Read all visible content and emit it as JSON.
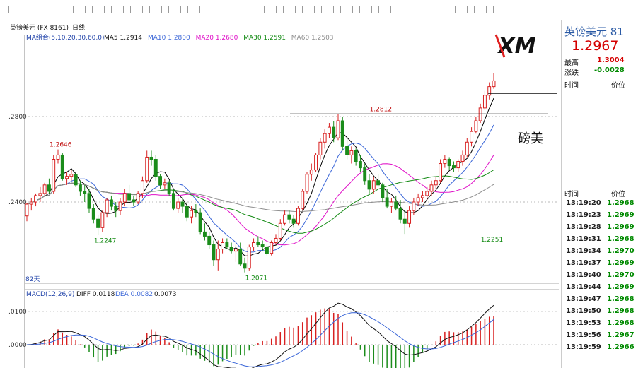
{
  "header": {
    "instrument": "英镑美元 (FX 8161)",
    "period": "日线",
    "ma_label": "MA组合(5,10,20,30,60,0)",
    "ma_values": [
      {
        "name": "MA5",
        "value": "1.2914",
        "color": "#000000"
      },
      {
        "name": "MA10",
        "value": "1.2800",
        "color": "#3a66d8"
      },
      {
        "name": "MA20",
        "value": "1.2680",
        "color": "#e010c8"
      },
      {
        "name": "MA30",
        "value": "1.2591",
        "color": "#138a13"
      },
      {
        "name": "MA60",
        "value": "1.2503",
        "color": "#8e8e8e"
      }
    ]
  },
  "chart_data": [
    {
      "type": "candlestick",
      "ylim": [
        1.202,
        1.318
      ],
      "y_ticks": [
        1.28,
        1.24
      ],
      "y_tick_labels": [
        ".2800",
        ".2400"
      ],
      "annotations": [
        {
          "text": "1.2646",
          "value": 1.2646,
          "index": 7
        },
        {
          "text": "1.2247",
          "value": 1.2247,
          "index": 17
        },
        {
          "text": "1.2812",
          "value": 1.2812,
          "index": 79
        },
        {
          "text": "1.2071",
          "value": 1.2071,
          "index": 51
        },
        {
          "text": "1.2251",
          "value": 1.2251,
          "index": 104
        }
      ],
      "hlines": [
        1.2812,
        1.2908
      ],
      "period_label": "82天",
      "ohlc": [
        [
          1.2335,
          1.2395,
          1.231,
          1.239
        ],
        [
          1.239,
          1.242,
          1.236,
          1.24
        ],
        [
          1.24,
          1.244,
          1.238,
          1.243
        ],
        [
          1.243,
          1.247,
          1.24,
          1.244
        ],
        [
          1.244,
          1.249,
          1.243,
          1.248
        ],
        [
          1.248,
          1.251,
          1.244,
          1.245
        ],
        [
          1.245,
          1.262,
          1.244,
          1.26
        ],
        [
          1.26,
          1.2646,
          1.258,
          1.262
        ],
        [
          1.262,
          1.263,
          1.25,
          1.251
        ],
        [
          1.251,
          1.254,
          1.248,
          1.252
        ],
        [
          1.252,
          1.255,
          1.25,
          1.253
        ],
        [
          1.253,
          1.254,
          1.247,
          1.248
        ],
        [
          1.248,
          1.25,
          1.243,
          1.245
        ],
        [
          1.245,
          1.248,
          1.24,
          1.244
        ],
        [
          1.244,
          1.246,
          1.235,
          1.237
        ],
        [
          1.237,
          1.239,
          1.23,
          1.232
        ],
        [
          1.232,
          1.234,
          1.2247,
          1.228
        ],
        [
          1.228,
          1.236,
          1.226,
          1.235
        ],
        [
          1.235,
          1.242,
          1.233,
          1.241
        ],
        [
          1.241,
          1.243,
          1.236,
          1.238
        ],
        [
          1.238,
          1.24,
          1.233,
          1.236
        ],
        [
          1.236,
          1.242,
          1.234,
          1.24
        ],
        [
          1.24,
          1.246,
          1.238,
          1.244
        ],
        [
          1.244,
          1.248,
          1.24,
          1.241
        ],
        [
          1.241,
          1.243,
          1.238,
          1.24
        ],
        [
          1.24,
          1.245,
          1.239,
          1.244
        ],
        [
          1.244,
          1.252,
          1.242,
          1.25
        ],
        [
          1.25,
          1.264,
          1.249,
          1.261
        ],
        [
          1.261,
          1.264,
          1.257,
          1.26
        ],
        [
          1.26,
          1.262,
          1.25,
          1.252
        ],
        [
          1.252,
          1.253,
          1.246,
          1.248
        ],
        [
          1.248,
          1.251,
          1.246,
          1.249
        ],
        [
          1.249,
          1.25,
          1.243,
          1.244
        ],
        [
          1.244,
          1.246,
          1.236,
          1.237
        ],
        [
          1.237,
          1.242,
          1.235,
          1.24
        ],
        [
          1.24,
          1.242,
          1.235,
          1.238
        ],
        [
          1.238,
          1.24,
          1.231,
          1.233
        ],
        [
          1.233,
          1.238,
          1.23,
          1.236
        ],
        [
          1.236,
          1.239,
          1.233,
          1.235
        ],
        [
          1.235,
          1.237,
          1.225,
          1.226
        ],
        [
          1.226,
          1.23,
          1.222,
          1.224
        ],
        [
          1.224,
          1.226,
          1.218,
          1.22
        ],
        [
          1.22,
          1.222,
          1.21,
          1.213
        ],
        [
          1.213,
          1.222,
          1.208,
          1.218
        ],
        [
          1.218,
          1.223,
          1.216,
          1.221
        ],
        [
          1.221,
          1.223,
          1.218,
          1.219
        ],
        [
          1.219,
          1.221,
          1.216,
          1.217
        ],
        [
          1.217,
          1.22,
          1.212,
          1.218
        ],
        [
          1.218,
          1.221,
          1.21,
          1.211
        ],
        [
          1.211,
          1.214,
          1.2071,
          1.209
        ],
        [
          1.209,
          1.22,
          1.208,
          1.219
        ],
        [
          1.219,
          1.223,
          1.217,
          1.221
        ],
        [
          1.221,
          1.224,
          1.219,
          1.22
        ],
        [
          1.22,
          1.222,
          1.217,
          1.219
        ],
        [
          1.219,
          1.22,
          1.215,
          1.216
        ],
        [
          1.216,
          1.222,
          1.215,
          1.221
        ],
        [
          1.221,
          1.225,
          1.22,
          1.223
        ],
        [
          1.223,
          1.232,
          1.222,
          1.23
        ],
        [
          1.23,
          1.236,
          1.229,
          1.234
        ],
        [
          1.234,
          1.236,
          1.23,
          1.232
        ],
        [
          1.232,
          1.234,
          1.228,
          1.23
        ],
        [
          1.23,
          1.238,
          1.229,
          1.237
        ],
        [
          1.237,
          1.246,
          1.236,
          1.245
        ],
        [
          1.245,
          1.254,
          1.244,
          1.253
        ],
        [
          1.253,
          1.258,
          1.25,
          1.255
        ],
        [
          1.255,
          1.263,
          1.254,
          1.262
        ],
        [
          1.262,
          1.27,
          1.26,
          1.268
        ],
        [
          1.268,
          1.274,
          1.265,
          1.272
        ],
        [
          1.272,
          1.277,
          1.27,
          1.275
        ],
        [
          1.275,
          1.278,
          1.268,
          1.27
        ],
        [
          1.27,
          1.2812,
          1.269,
          1.278
        ],
        [
          1.278,
          1.28,
          1.264,
          1.266
        ],
        [
          1.266,
          1.27,
          1.26,
          1.262
        ],
        [
          1.262,
          1.266,
          1.258,
          1.264
        ],
        [
          1.264,
          1.265,
          1.257,
          1.259
        ],
        [
          1.259,
          1.262,
          1.254,
          1.256
        ],
        [
          1.256,
          1.258,
          1.248,
          1.25
        ],
        [
          1.25,
          1.253,
          1.244,
          1.246
        ],
        [
          1.246,
          1.252,
          1.244,
          1.25
        ],
        [
          1.25,
          1.253,
          1.247,
          1.248
        ],
        [
          1.248,
          1.249,
          1.24,
          1.242
        ],
        [
          1.242,
          1.246,
          1.237,
          1.238
        ],
        [
          1.238,
          1.242,
          1.235,
          1.24
        ],
        [
          1.24,
          1.243,
          1.236,
          1.237
        ],
        [
          1.237,
          1.241,
          1.23,
          1.232
        ],
        [
          1.232,
          1.236,
          1.2251,
          1.23
        ],
        [
          1.23,
          1.238,
          1.228,
          1.236
        ],
        [
          1.236,
          1.242,
          1.234,
          1.24
        ],
        [
          1.24,
          1.244,
          1.238,
          1.242
        ],
        [
          1.242,
          1.245,
          1.24,
          1.243
        ],
        [
          1.243,
          1.247,
          1.241,
          1.245
        ],
        [
          1.245,
          1.25,
          1.243,
          1.248
        ],
        [
          1.248,
          1.252,
          1.246,
          1.25
        ],
        [
          1.25,
          1.26,
          1.249,
          1.258
        ],
        [
          1.258,
          1.262,
          1.256,
          1.26
        ],
        [
          1.26,
          1.261,
          1.255,
          1.257
        ],
        [
          1.257,
          1.259,
          1.254,
          1.256
        ],
        [
          1.256,
          1.26,
          1.254,
          1.259
        ],
        [
          1.259,
          1.264,
          1.257,
          1.262
        ],
        [
          1.262,
          1.27,
          1.261,
          1.268
        ],
        [
          1.268,
          1.275,
          1.266,
          1.273
        ],
        [
          1.273,
          1.28,
          1.272,
          1.278
        ],
        [
          1.278,
          1.286,
          1.277,
          1.284
        ],
        [
          1.284,
          1.292,
          1.283,
          1.29
        ],
        [
          1.29,
          1.296,
          1.288,
          1.294
        ],
        [
          1.294,
          1.3004,
          1.293,
          1.2967
        ]
      ]
    },
    {
      "type": "macd",
      "label": "MACD(12,26,9)",
      "diff_label": "DIFF 0.0118",
      "dea_label": "DEA 0.0082",
      "macd_label": "0.0073",
      "ylim": [
        -0.007,
        0.014
      ],
      "y_ticks": [
        0.01,
        0.0
      ],
      "y_tick_labels": [
        ".0100",
        ".0000"
      ]
    }
  ],
  "right_panel": {
    "title": "英镑美元 81",
    "price": "1.2967",
    "high_label": "最高",
    "high_value": "1.3004",
    "change_label": "涨跌",
    "change_value": "-0.0028",
    "col_time": "时间",
    "col_price": "价位",
    "ticks": [
      {
        "time": "13:19:20",
        "price": "1.2968"
      },
      {
        "time": "13:19:23",
        "price": "1.2969"
      },
      {
        "time": "13:19:28",
        "price": "1.2969"
      },
      {
        "time": "13:19:31",
        "price": "1.2968"
      },
      {
        "time": "13:19:34",
        "price": "1.2970"
      },
      {
        "time": "13:19:37",
        "price": "1.2969"
      },
      {
        "time": "13:19:40",
        "price": "1.2970"
      },
      {
        "time": "13:19:44",
        "price": "1.2969"
      },
      {
        "time": "13:19:47",
        "price": "1.2968"
      },
      {
        "time": "13:19:50",
        "price": "1.2968"
      },
      {
        "time": "13:19:53",
        "price": "1.2968"
      },
      {
        "time": "13:19:56",
        "price": "1.2967"
      },
      {
        "time": "13:19:59",
        "price": "1.2966"
      }
    ]
  },
  "overlay": {
    "watermark": "磅美",
    "logo": "XM"
  },
  "colors": {
    "up": "#d82020",
    "down": "#1b8c1b",
    "grid": "#b8b8b8"
  }
}
